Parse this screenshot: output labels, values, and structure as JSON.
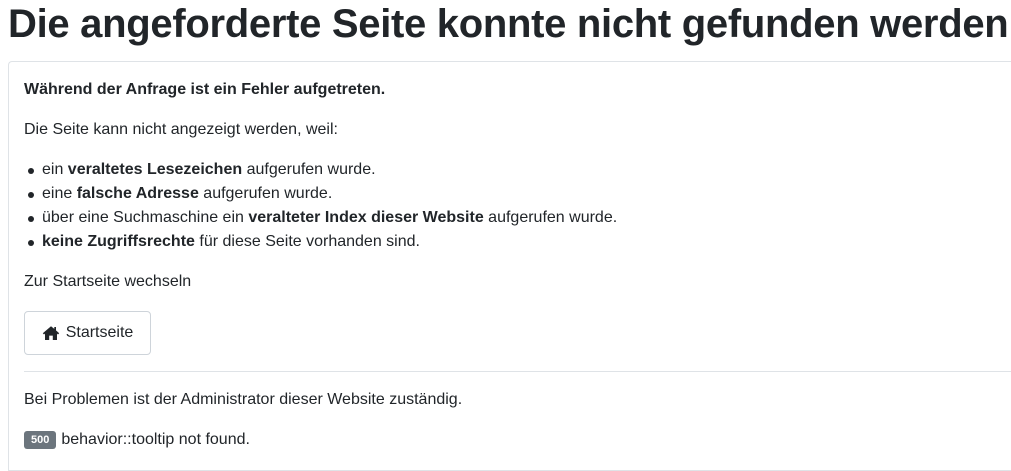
{
  "page": {
    "title": "Die angeforderte Seite konnte nicht gefunden werden."
  },
  "card": {
    "heading": "Während der Anfrage ist ein Fehler aufgetreten.",
    "intro": "Die Seite kann nicht angezeigt werden, weil:",
    "reasons": [
      {
        "pre": "ein ",
        "bold": "veraltetes Lesezeichen",
        "post": " aufgerufen wurde."
      },
      {
        "pre": "eine ",
        "bold": "falsche Adresse",
        "post": " aufgerufen wurde."
      },
      {
        "pre": "über eine Suchmaschine ein ",
        "bold": "veralteter Index dieser Website",
        "post": " aufgerufen wurde."
      },
      {
        "pre": "",
        "bold": "keine Zugriffsrechte",
        "post": " für diese Seite vorhanden sind."
      }
    ],
    "home_hint": "Zur Startseite wechseln",
    "home_button": {
      "label": "Startseite",
      "icon": "home-icon"
    },
    "admin_note": "Bei Problemen ist der Administrator dieser Website zuständig.",
    "error": {
      "code": "500",
      "message": "behavior::tooltip not found."
    }
  },
  "colors": {
    "text": "#212529",
    "badge_bg": "#6c757d",
    "border": "#dfe3e7"
  }
}
